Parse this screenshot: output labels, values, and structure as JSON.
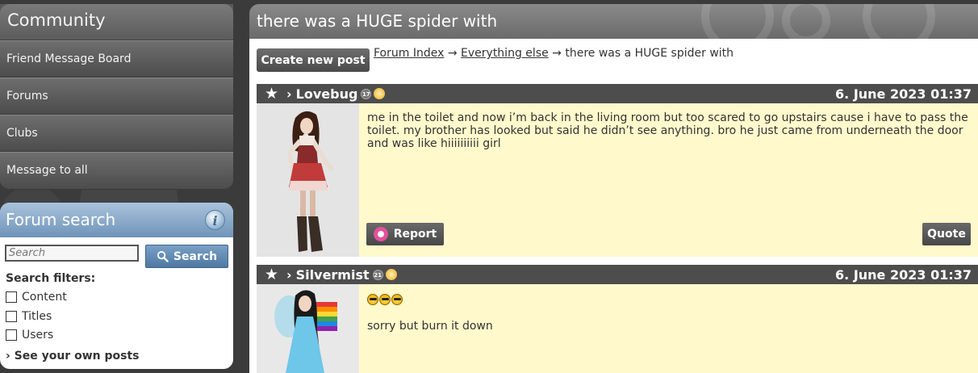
{
  "sidebar": {
    "community_title": "Community",
    "nav_items": [
      {
        "label": "Friend Message Board"
      },
      {
        "label": "Forums"
      },
      {
        "label": "Clubs"
      },
      {
        "label": "Message to all"
      }
    ],
    "search": {
      "title": "Forum search",
      "info_icon": "info-icon",
      "input_placeholder": "Search",
      "input_value": "",
      "button_label": "Search",
      "button_icon": "magnifier-icon",
      "filters_label": "Search filters:",
      "filters": [
        {
          "label": "Content",
          "checked": false
        },
        {
          "label": "Titles",
          "checked": false
        },
        {
          "label": "Users",
          "checked": false
        }
      ],
      "own_posts_link": "› See your own posts"
    }
  },
  "main": {
    "title": "there was a HUGE spider with",
    "create_button": "Create new post",
    "breadcrumb": {
      "forum_index": "Forum Index",
      "sep1": " → ",
      "category": "Everything else",
      "sep2": " → ",
      "current": "there was a HUGE spider with"
    },
    "posts": [
      {
        "arrow": "›",
        "author": "Lovebug",
        "level": "17",
        "date": "6. June 2023 01:37",
        "message": "me in the toilet and now i’m back in the living room but too scared to go upstairs cause i have to pass the toilet. my brother has looked but said he didn’t see anything. bro he just came from underneath the door and was like hiiiiiiiiii girl",
        "report_label": "Report",
        "quote_label": "Quote"
      },
      {
        "arrow": "›",
        "author": "Silvermist",
        "level": "21",
        "date": "6. June 2023 01:37",
        "emoji_count": 3,
        "message": "sorry but burn it down"
      }
    ]
  },
  "colors": {
    "page_bg": "#3a3a3a",
    "post_header": "#4d4d4d",
    "post_body": "#fff9cc",
    "search_header": "#6f94b9"
  }
}
